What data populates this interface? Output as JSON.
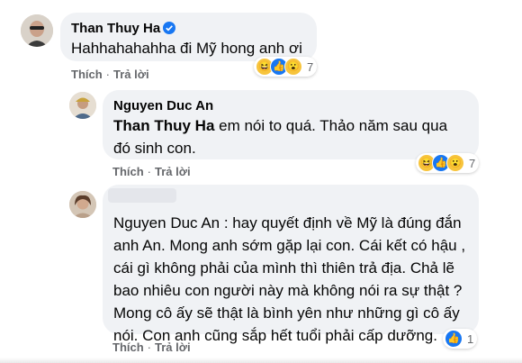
{
  "comments": [
    {
      "author": "Than Thuy Ha",
      "verified": true,
      "text": "Hahhahahahha đi Mỹ hong anh ơi",
      "actions": {
        "like": "Thích",
        "reply": "Trả lời"
      },
      "reactions": {
        "icons": [
          "haha-icon",
          "like-icon",
          "wow-icon"
        ],
        "count": "7"
      }
    },
    {
      "author": "Nguyen Duc An",
      "mention": "Than Thuy Ha",
      "text": " em nói to quá. Thảo năm sau qua đó sinh con.",
      "actions": {
        "like": "Thích",
        "reply": "Trả lời"
      },
      "reactions": {
        "icons": [
          "haha-icon",
          "like-icon",
          "wow-icon"
        ],
        "count": "7"
      }
    },
    {
      "author": "",
      "text": "Nguyen Duc An : hay quyết định về Mỹ là đúng đắn anh An. Mong anh sớm gặp lại con. Cái kết có hậu , cái gì không phải của mình thì thiên trả địa. Chả lẽ bao nhiêu con người này mà không nói ra sự thật ? Mong cô ấy sẽ thật là bình yên như những gì cô ấy nói. Con anh cũng sắp hết tuổi phải cấp dưỡng.",
      "actions": {
        "like": "Thích",
        "reply": "Trả lời"
      },
      "reactions": {
        "icons": [
          "like-icon"
        ],
        "count": "1"
      }
    }
  ],
  "colors": {
    "bubble": "#f0f2f5",
    "like": "#1877f2",
    "haha": "#f7c43c",
    "meta": "#65676b"
  }
}
